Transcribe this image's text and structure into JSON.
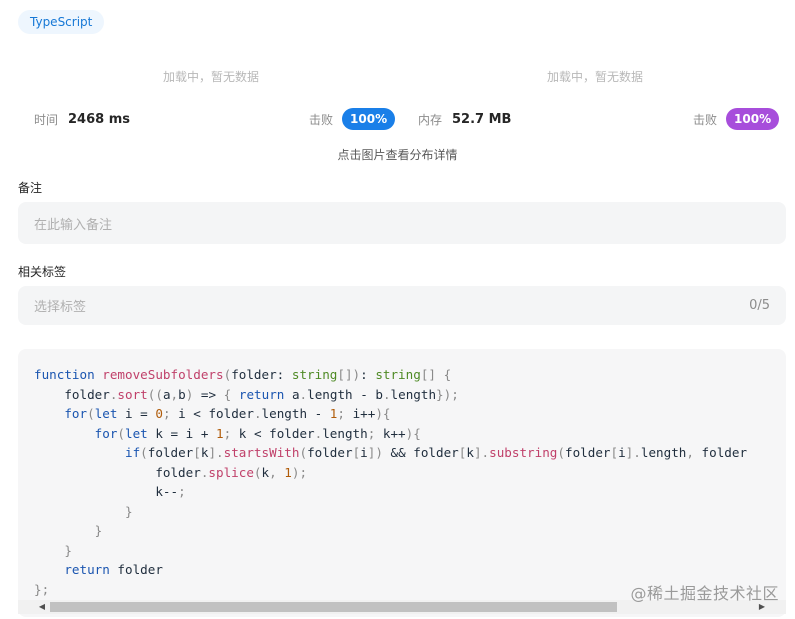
{
  "language_tag": "TypeScript",
  "charts": {
    "runtime_placeholder": "加载中，暂无数据",
    "memory_placeholder": "加载中，暂无数据"
  },
  "stats": {
    "time_label": "时间",
    "time_value": "2468 ms",
    "time_beat_label": "击败",
    "time_beat_value": "100%",
    "memory_label": "内存",
    "memory_value": "52.7 MB",
    "memory_beat_label": "击败",
    "memory_beat_value": "100%"
  },
  "hint": "点击图片查看分布详情",
  "notes": {
    "label": "备注",
    "placeholder": "在此输入备注"
  },
  "tags": {
    "label": "相关标签",
    "placeholder": "选择标签",
    "counter": "0/5"
  },
  "code": {
    "lines": [
      "function removeSubfolders(folder: string[]): string[] {",
      "    folder.sort((a,b) => { return a.length - b.length});",
      "    for(let i = 0; i < folder.length - 1; i++){",
      "        for(let k = i + 1; k < folder.length; k++){",
      "            if(folder[k].startsWith(folder[i]) && folder[k].substring(folder[i].length, folder",
      "                folder.splice(k, 1);",
      "                k--;",
      "            }",
      "        }",
      "    }",
      "    return folder",
      "};"
    ]
  },
  "watermark": "@稀土掘金技术社区",
  "colors": {
    "beat_time": "#1a7fe8",
    "beat_memory": "#a74ddb",
    "tag_text": "#1678d6"
  }
}
